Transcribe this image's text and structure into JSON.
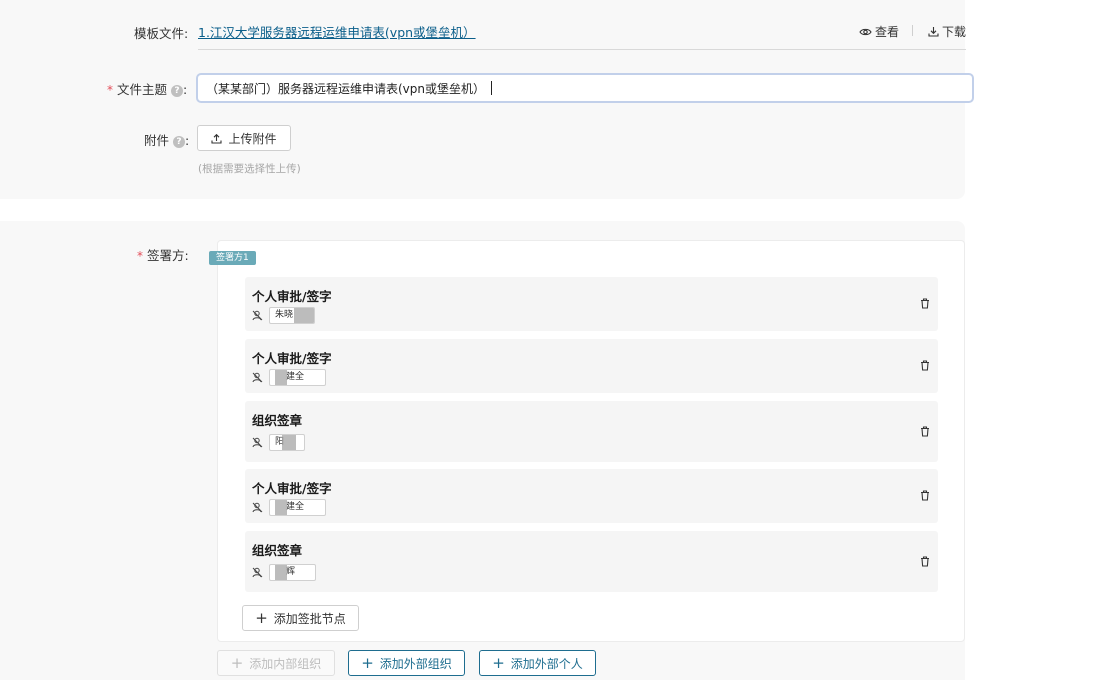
{
  "template": {
    "label": "模板文件",
    "file_link": "1.江汉大学服务器远程运维申请表(vpn或堡垒机）",
    "view_label": "查看",
    "download_label": "下载"
  },
  "subject": {
    "label": "文件主题",
    "value": "（某某部门）服务器远程运维申请表(vpn或堡垒机）"
  },
  "attachment": {
    "label": "附件",
    "upload_label": "上传附件",
    "hint": "(根据需要选择性上传)"
  },
  "signers": {
    "label": "签署方",
    "tag": "签署方1",
    "nodes": [
      {
        "title": "个人审批/签字",
        "person": "朱晓"
      },
      {
        "title": "个人审批/签字",
        "person": "建全"
      },
      {
        "title": "组织签章",
        "person": "阳"
      },
      {
        "title": "个人审批/签字",
        "person": "建全"
      },
      {
        "title": "组织签章",
        "person": "辉"
      }
    ],
    "add_node_label": "添加签批节点"
  },
  "bottom_actions": {
    "add_internal_org": "添加内部组织",
    "add_external_org": "添加外部组织",
    "add_external_person": "添加外部个人"
  },
  "colors": {
    "accent": "#1e6d8f",
    "link": "#0a5e8a",
    "required": "#e34d59",
    "tag": "#6aaab8"
  }
}
